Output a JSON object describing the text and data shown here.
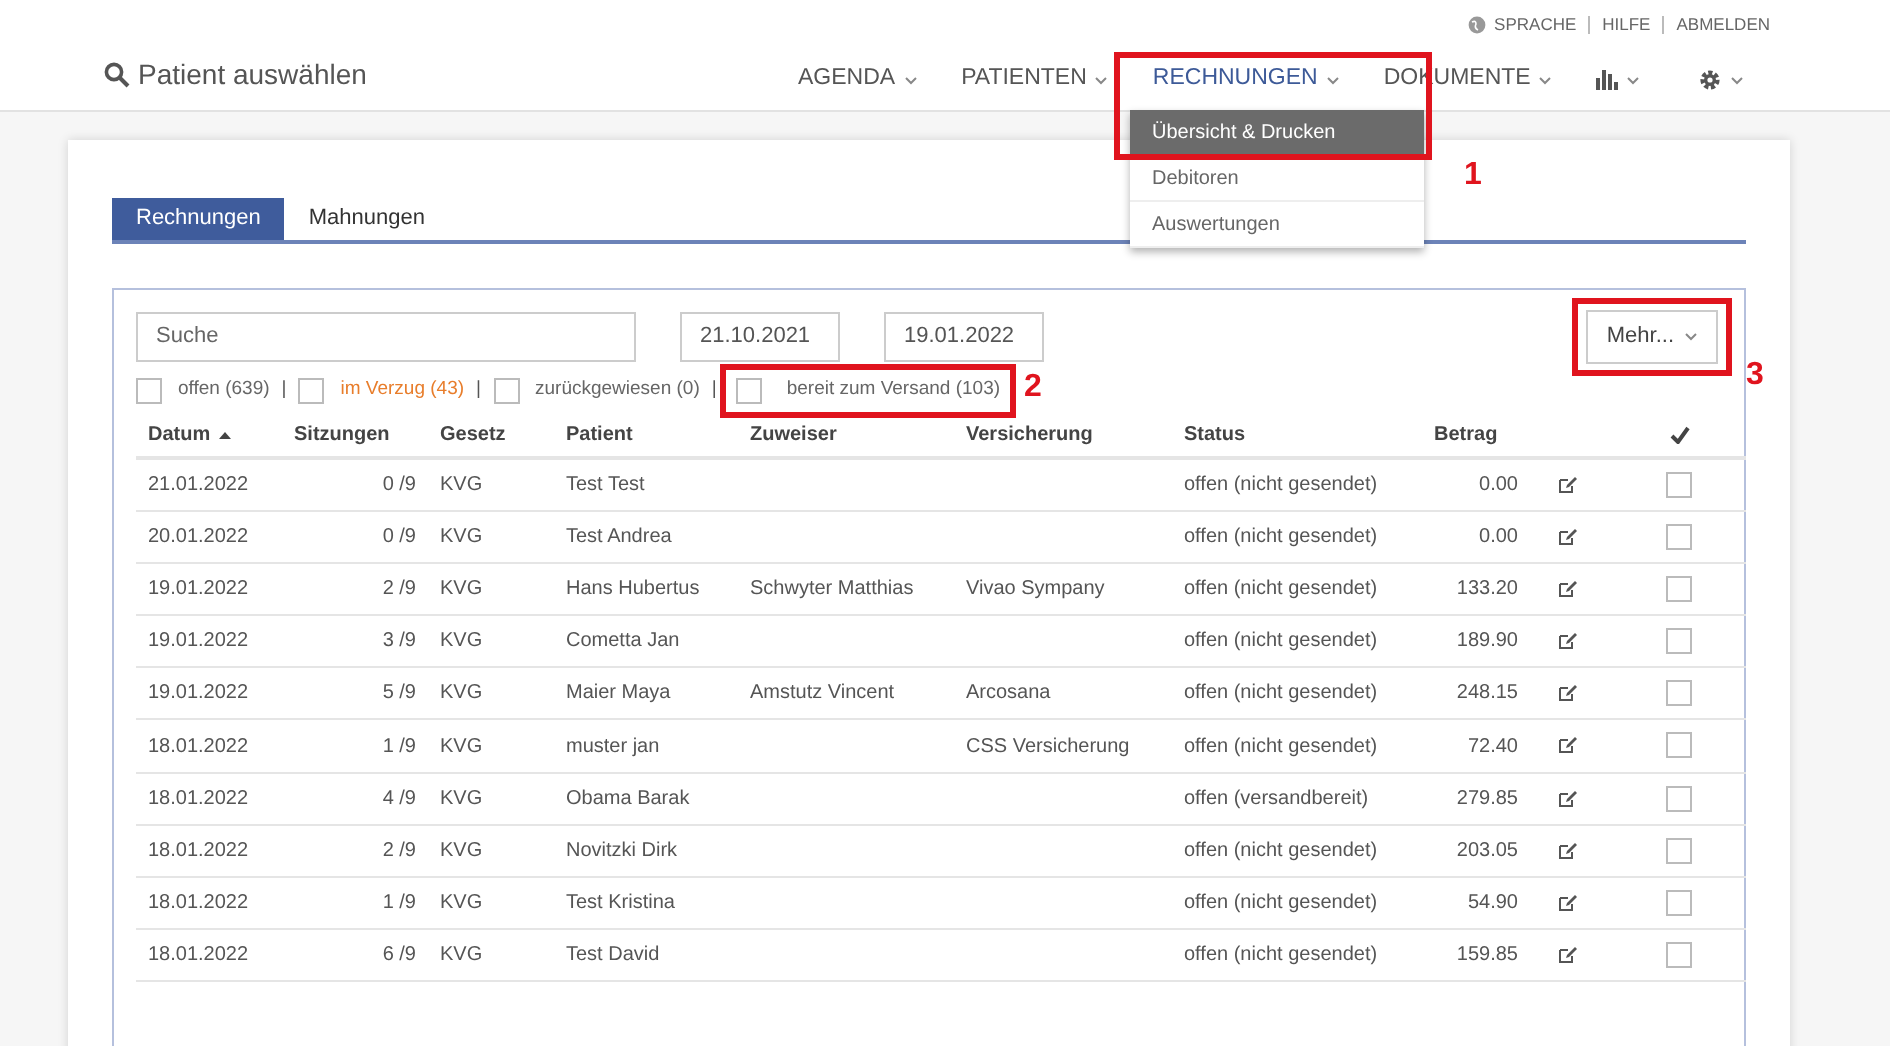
{
  "top_links": [
    {
      "label": "SPRACHE",
      "kind": "language"
    },
    {
      "label": "HILFE",
      "kind": "link"
    },
    {
      "label": "ABMELDEN",
      "kind": "link"
    }
  ],
  "patient_search": {
    "label": "Patient auswählen"
  },
  "nav": [
    {
      "label": "AGENDA",
      "kind": "text",
      "selected": false
    },
    {
      "label": "PATIENTEN",
      "kind": "text",
      "selected": false
    },
    {
      "label": "RECHNUNGEN",
      "kind": "text",
      "selected": true
    },
    {
      "label": "DOKUMENTE",
      "kind": "text",
      "selected": false
    },
    {
      "kind": "chart"
    },
    {
      "kind": "settings"
    }
  ],
  "dropdown": [
    {
      "label": "Übersicht & Drucken",
      "selected": true
    },
    {
      "label": "Debitoren",
      "selected": false
    },
    {
      "label": "Auswertungen",
      "selected": false
    }
  ],
  "tabs": [
    {
      "label": "Rechnungen",
      "selected": true
    },
    {
      "label": "Mahnungen",
      "selected": false
    }
  ],
  "search": {
    "placeholder": "Suche"
  },
  "date_from": "21.10.2021",
  "date_to": "19.01.2022",
  "more_button": "Mehr...",
  "filters": [
    {
      "label": "offen (639)",
      "checked": false,
      "color": "#666666"
    },
    {
      "separator": "|",
      "label": "im Verzug (43)",
      "checked": false,
      "color": "#e87d2b"
    },
    {
      "separator": "|",
      "label": "zurückgewiesen (0)",
      "checked": false,
      "color": "#666666"
    },
    {
      "separator": "|",
      "label": "bereit zum Versand (103)",
      "checked": false,
      "color": "#666666"
    }
  ],
  "columns": [
    "Datum",
    "Sitzungen",
    "Gesetz",
    "Patient",
    "Zuweiser",
    "Versicherung",
    "Status",
    "Betrag"
  ],
  "rows": [
    {
      "date": "21.01.2022",
      "sessions": "0 /9",
      "law": "KVG",
      "patient": "Test Test",
      "referrer": "",
      "insurance": "",
      "status": "offen (nicht gesendet)",
      "amount": "0.00",
      "checked": false
    },
    {
      "date": "20.01.2022",
      "sessions": "0 /9",
      "law": "KVG",
      "patient": "Test Andrea",
      "referrer": "",
      "insurance": "",
      "status": "offen (nicht gesendet)",
      "amount": "0.00",
      "checked": false
    },
    {
      "date": "19.01.2022",
      "sessions": "2 /9",
      "law": "KVG",
      "patient": "Hans Hubertus",
      "referrer": "Schwyter Matthias",
      "insurance": "Vivao Sympany",
      "status": "offen (nicht gesendet)",
      "amount": "133.20",
      "checked": false
    },
    {
      "date": "19.01.2022",
      "sessions": "3 /9",
      "law": "KVG",
      "patient": "Cometta Jan",
      "referrer": "",
      "insurance": "",
      "status": "offen (nicht gesendet)",
      "amount": "189.90",
      "checked": false
    },
    {
      "date": "19.01.2022",
      "sessions": "5 /9",
      "law": "KVG",
      "patient": "Maier Maya",
      "referrer": "Amstutz Vincent",
      "insurance": "Arcosana",
      "status": "offen (nicht gesendet)",
      "amount": "248.15",
      "checked": false
    },
    {
      "date": "18.01.2022",
      "sessions": "1 /9",
      "law": "KVG",
      "patient": "muster jan",
      "referrer": "",
      "insurance": "CSS Versicherung",
      "status": "offen (nicht gesendet)",
      "amount": "72.40",
      "checked": false
    },
    {
      "date": "18.01.2022",
      "sessions": "4 /9",
      "law": "KVG",
      "patient": "Obama Barak",
      "referrer": "",
      "insurance": "",
      "status": "offen (versandbereit)",
      "amount": "279.85",
      "checked": false
    },
    {
      "date": "18.01.2022",
      "sessions": "2 /9",
      "law": "KVG",
      "patient": "Novitzki Dirk",
      "referrer": "",
      "insurance": "",
      "status": "offen (nicht gesendet)",
      "amount": "203.05",
      "checked": false
    },
    {
      "date": "18.01.2022",
      "sessions": "1 /9",
      "law": "KVG",
      "patient": "Test Kristina",
      "referrer": "",
      "insurance": "",
      "status": "offen (nicht gesendet)",
      "amount": "54.90",
      "checked": false
    },
    {
      "date": "18.01.2022",
      "sessions": "6 /9",
      "law": "KVG",
      "patient": "Test David",
      "referrer": "",
      "insurance": "",
      "status": "offen (nicht gesendet)",
      "amount": "159.85",
      "checked": false
    }
  ],
  "callouts": [
    {
      "number": "1"
    },
    {
      "number": "2"
    },
    {
      "number": "3"
    }
  ]
}
